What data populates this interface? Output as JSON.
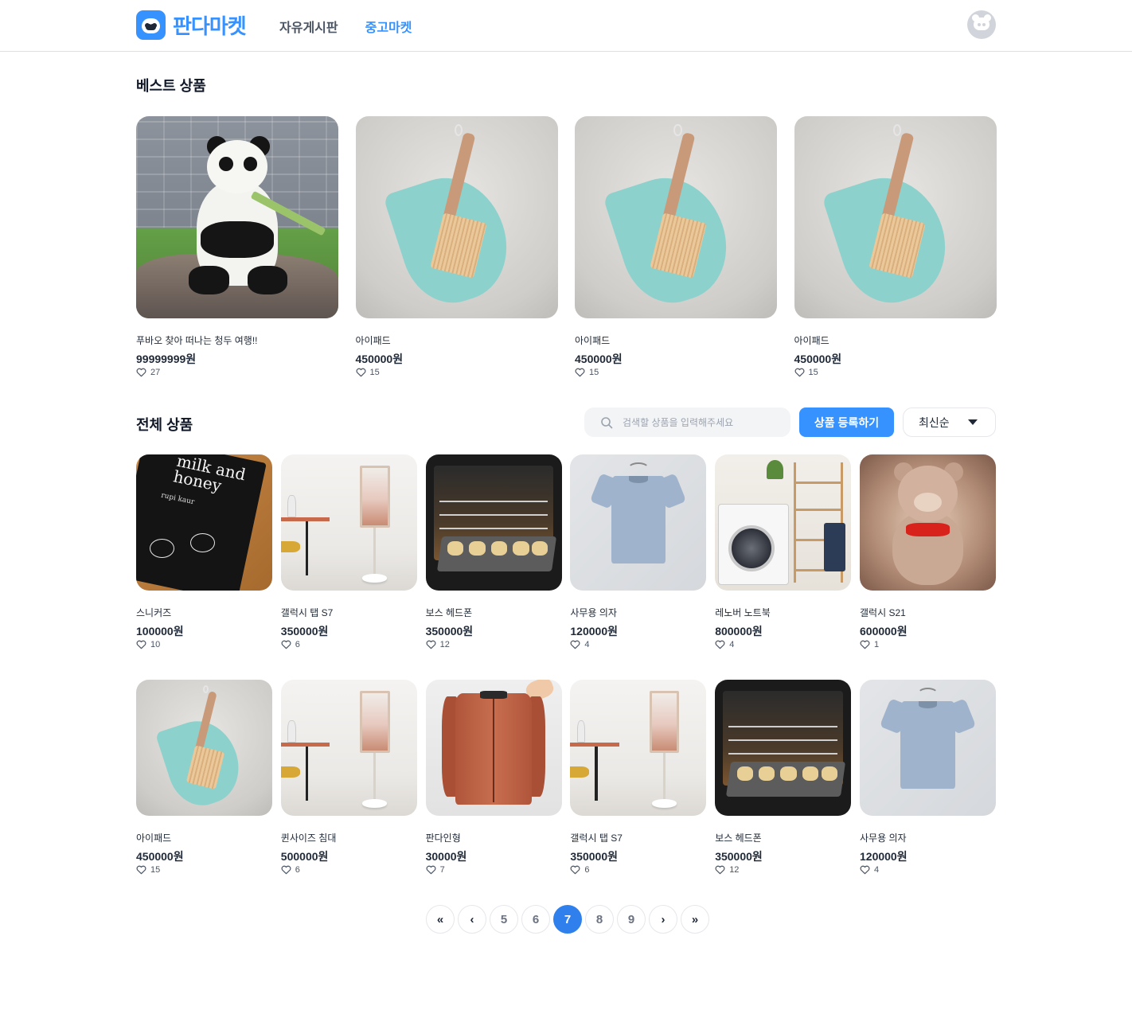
{
  "header": {
    "logo_text": "판다마켓",
    "nav": [
      {
        "label": "자유게시판",
        "active": false
      },
      {
        "label": "중고마켓",
        "active": true
      }
    ]
  },
  "best": {
    "title": "베스트 상품",
    "items": [
      {
        "name": "푸바오 찾아 떠나는 청두 여행!!",
        "price": "99999999원",
        "likes": "27",
        "image": "panda"
      },
      {
        "name": "아이패드",
        "price": "450000원",
        "likes": "15",
        "image": "dustpan-brush"
      },
      {
        "name": "아이패드",
        "price": "450000원",
        "likes": "15",
        "image": "dustpan-brush"
      },
      {
        "name": "아이패드",
        "price": "450000원",
        "likes": "15",
        "image": "dustpan-brush"
      }
    ]
  },
  "all": {
    "title": "전체 상품",
    "search_placeholder": "검색할 상품을 입력해주세요",
    "register_label": "상품 등록하기",
    "sort_label": "최신순",
    "book_cover_text": "milk and honey",
    "book_cover_author": "rupi kaur",
    "items": [
      {
        "name": "스니커즈",
        "price": "100000원",
        "likes": "10",
        "image": "book"
      },
      {
        "name": "갤럭시 탭 S7",
        "price": "350000원",
        "likes": "6",
        "image": "stand-screen"
      },
      {
        "name": "보스 헤드폰",
        "price": "350000원",
        "likes": "12",
        "image": "oven"
      },
      {
        "name": "사무용 의자",
        "price": "120000원",
        "likes": "4",
        "image": "t-shirt"
      },
      {
        "name": "레노버 노트북",
        "price": "800000원",
        "likes": "4",
        "image": "laundry"
      },
      {
        "name": "갤럭시 S21",
        "price": "600000원",
        "likes": "1",
        "image": "teddy-bear"
      },
      {
        "name": "아이패드",
        "price": "450000원",
        "likes": "15",
        "image": "dustpan-brush"
      },
      {
        "name": "퀸사이즈 침대",
        "price": "500000원",
        "likes": "6",
        "image": "stand-screen"
      },
      {
        "name": "판다인형",
        "price": "30000원",
        "likes": "7",
        "image": "jacket"
      },
      {
        "name": "갤럭시 탭 S7",
        "price": "350000원",
        "likes": "6",
        "image": "stand-screen"
      },
      {
        "name": "보스 헤드폰",
        "price": "350000원",
        "likes": "12",
        "image": "oven"
      },
      {
        "name": "사무용 의자",
        "price": "120000원",
        "likes": "4",
        "image": "t-shirt"
      }
    ]
  },
  "pagination": {
    "first": "«",
    "prev": "‹",
    "pages": [
      "5",
      "6",
      "7",
      "8",
      "9"
    ],
    "current": "7",
    "next": "›",
    "last": "»"
  },
  "colors": {
    "accent": "#3692ff",
    "active_page": "#2f80ed"
  }
}
